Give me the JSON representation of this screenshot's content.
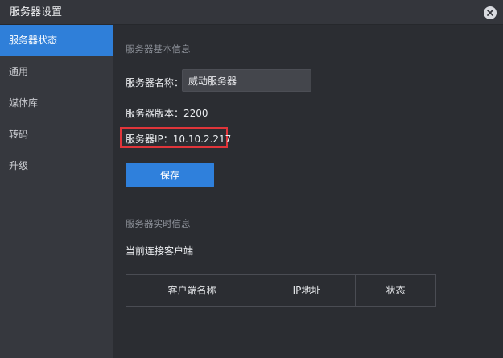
{
  "window": {
    "title": "服务器设置",
    "close_icon": "close-icon"
  },
  "sidebar": {
    "items": [
      {
        "label": "服务器状态",
        "active": true
      },
      {
        "label": "通用",
        "active": false
      },
      {
        "label": "媒体库",
        "active": false
      },
      {
        "label": "转码",
        "active": false
      },
      {
        "label": "升级",
        "active": false
      }
    ]
  },
  "basic_info": {
    "section_title": "服务器基本信息",
    "name_label": "服务器名称：",
    "name_value": "威动服务器",
    "version_text": "服务器版本：2200",
    "ip_text": "服务器IP：10.10.2.217",
    "save_label": "保存"
  },
  "realtime_info": {
    "section_title": "服务器实时信息",
    "clients_label": "当前连接客户端",
    "table_headers": [
      "客户端名称",
      "IP地址",
      "状态"
    ]
  },
  "colors": {
    "accent": "#2f80dc",
    "highlight_border": "#e0353a"
  }
}
